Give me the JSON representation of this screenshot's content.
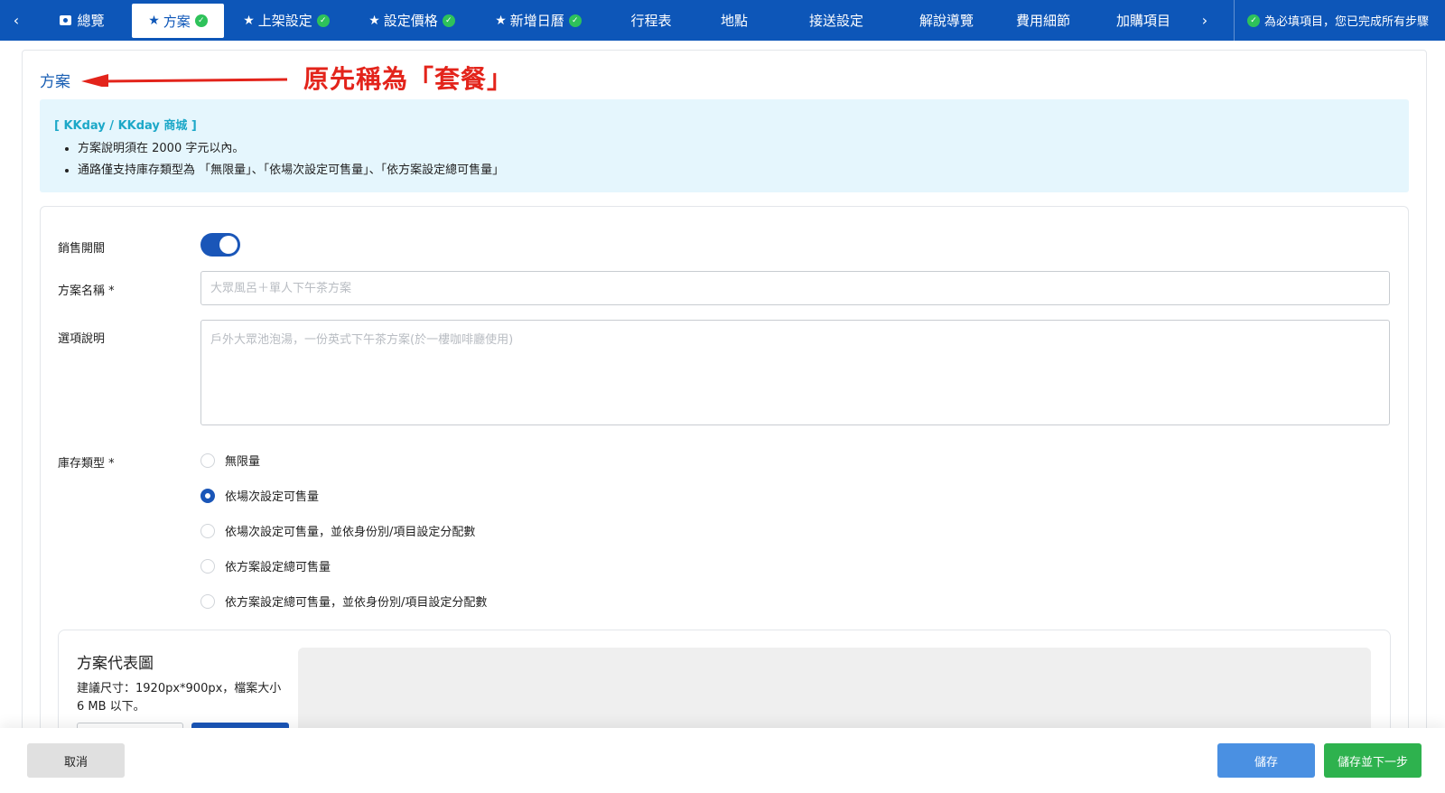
{
  "nav": {
    "prev": "‹",
    "next": "›",
    "tabs": [
      {
        "label": "總覽"
      },
      {
        "label": "方案"
      },
      {
        "label": "上架設定"
      },
      {
        "label": "設定價格"
      },
      {
        "label": "新增日曆"
      },
      {
        "label": "行程表"
      },
      {
        "label": "地點"
      },
      {
        "label": "接送設定"
      },
      {
        "label": "解說導覽"
      },
      {
        "label": "費用細節"
      },
      {
        "label": "加購項目"
      }
    ],
    "status": "為必填項目，您已完成所有步驟",
    "active_color": "#0d56b8",
    "check_color": "#2ec25a"
  },
  "section": {
    "title": "方案",
    "annotation": "原先稱為「套餐」",
    "annotation_color": "#e3241b"
  },
  "info": {
    "title": "[ KKday / KKday 商城 ]",
    "items": [
      "方案說明須在 2000 字元以內。",
      "通路僅支持庫存類型為 「無限量」、「依場次設定可售量」、「依方案設定總可售量」"
    ]
  },
  "form": {
    "sale_toggle_label": "銷售開關",
    "sale_toggle_on": true,
    "name_label": "方案名稱 *",
    "name_placeholder": "大眾風呂＋單人下午茶方案",
    "desc_label": "選項說明",
    "desc_placeholder": "戶外大眾池泡湯，一份英式下午茶方案(於一樓咖啡廳使用)",
    "stock_label": "庫存類型 *",
    "stock_options": [
      "無限量",
      "依場次設定可售量",
      "依場次設定可售量，並依身份別/項目設定分配數",
      "依方案設定總可售量",
      "依方案設定總可售量，並依身份別/項目設定分配數"
    ],
    "stock_selected_index": 1
  },
  "image_section": {
    "title": "方案代表圖",
    "desc": "建議尺寸：1920px*900px，檔案大小 6 MB 以下。"
  },
  "footer": {
    "cancel": "取消",
    "save": "儲存",
    "save_next": "儲存並下一步"
  }
}
